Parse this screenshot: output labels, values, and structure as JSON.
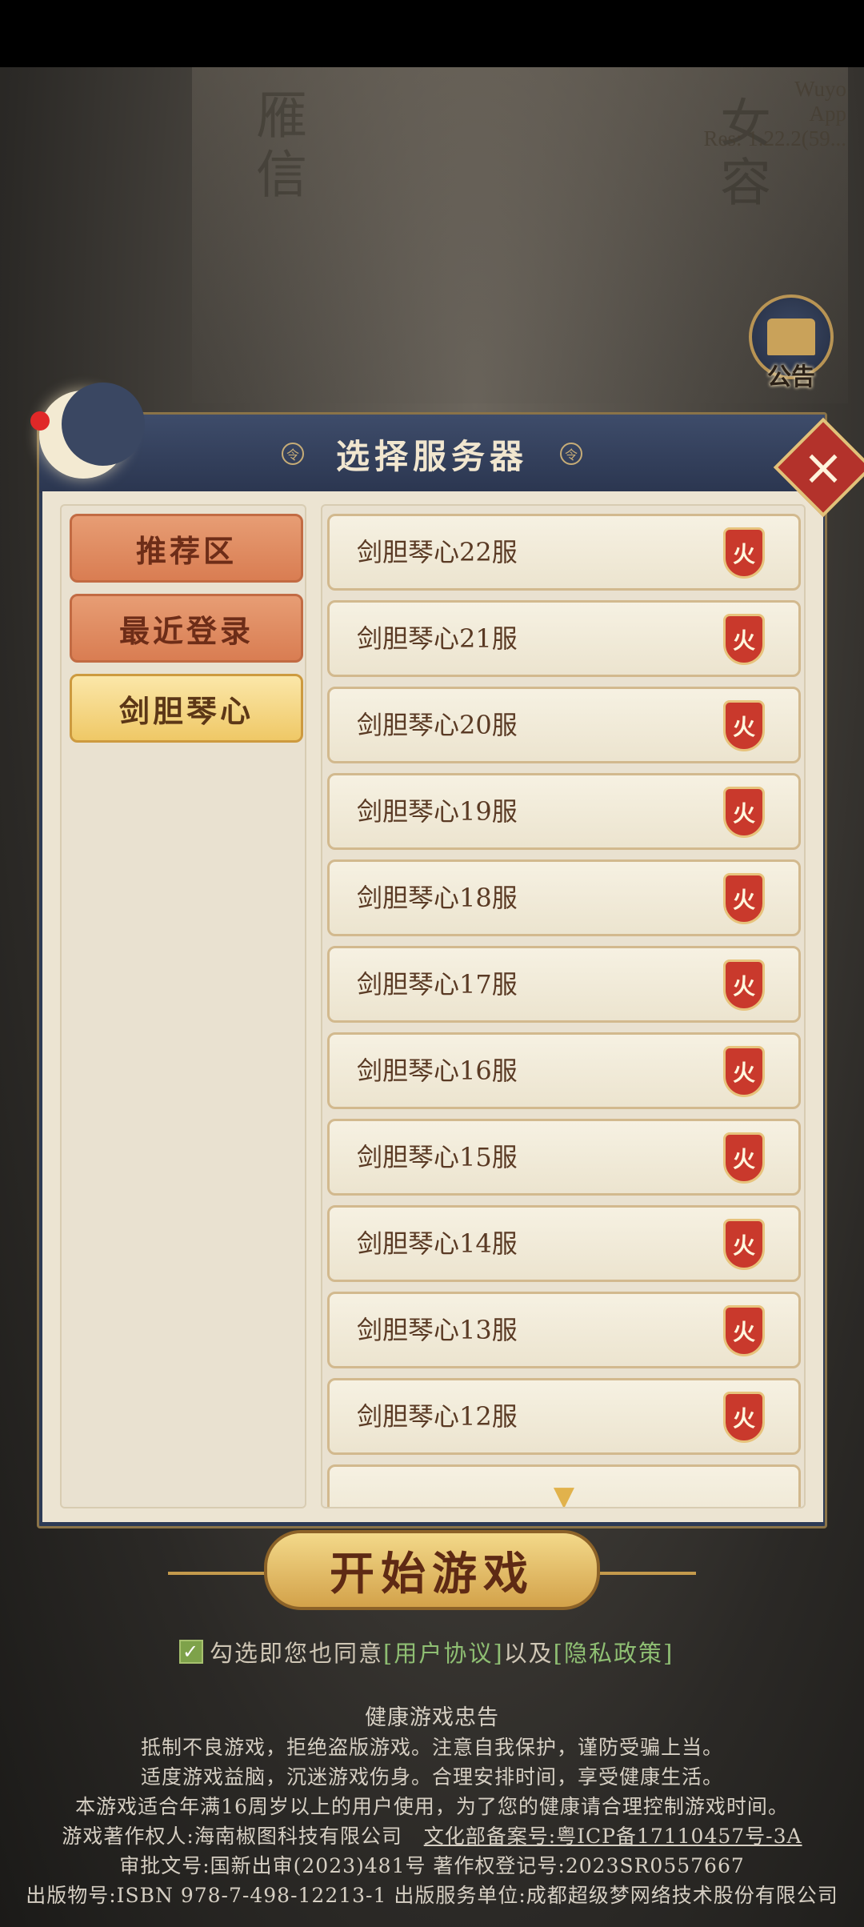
{
  "version_info": {
    "line1": "Wuyo",
    "line2": "App",
    "line3": "Res: 1.22.2(59..."
  },
  "notice_button": {
    "label": "公告"
  },
  "dialog": {
    "title": "选择服务器",
    "close_label": "×",
    "categories": [
      {
        "label": "推荐区",
        "state": "normal"
      },
      {
        "label": "最近登录",
        "state": "normal"
      },
      {
        "label": "剑胆琴心",
        "state": "selected"
      }
    ],
    "servers": [
      {
        "name": "剑胆琴心22服",
        "status": "火"
      },
      {
        "name": "剑胆琴心21服",
        "status": "火"
      },
      {
        "name": "剑胆琴心20服",
        "status": "火"
      },
      {
        "name": "剑胆琴心19服",
        "status": "火"
      },
      {
        "name": "剑胆琴心18服",
        "status": "火"
      },
      {
        "name": "剑胆琴心17服",
        "status": "火"
      },
      {
        "name": "剑胆琴心16服",
        "status": "火"
      },
      {
        "name": "剑胆琴心15服",
        "status": "火"
      },
      {
        "name": "剑胆琴心14服",
        "status": "火"
      },
      {
        "name": "剑胆琴心13服",
        "status": "火"
      },
      {
        "name": "剑胆琴心12服",
        "status": "火"
      }
    ],
    "more_indicator": "▼"
  },
  "start_button": {
    "label": "开始游戏"
  },
  "agreement": {
    "prefix": "勾选即您也同意",
    "user_agreement": "[用户协议]",
    "middle": "以及",
    "privacy_policy": "[隐私政策]",
    "checked": true
  },
  "health_notice": {
    "title": "健康游戏忠告",
    "line1": "抵制不良游戏，拒绝盗版游戏。注意自我保护，谨防受骗上当。",
    "line2": "适度游戏益脑，沉迷游戏伤身。合理安排时间，享受健康生活。",
    "line3": "本游戏适合年满16周岁以上的用户使用，为了您的健康请合理控制游戏时间。",
    "copyright_owner": "游戏著作权人:海南椒图科技有限公司",
    "icp": "文化部备案号:粤ICP备17110457号-3A",
    "approval": "审批文号:国新出审(2023)481号 著作权登记号:2023SR0557667",
    "isbn": "出版物号:ISBN 978-7-498-12213-1 出版服务单位:成都超级梦网络技术股份有限公司"
  },
  "colors": {
    "dialog_frame": "#2c3a55",
    "category_normal": "#d97d52",
    "category_active": "#efc866",
    "fire_badge": "#c9392c",
    "link": "#8fbf73"
  }
}
